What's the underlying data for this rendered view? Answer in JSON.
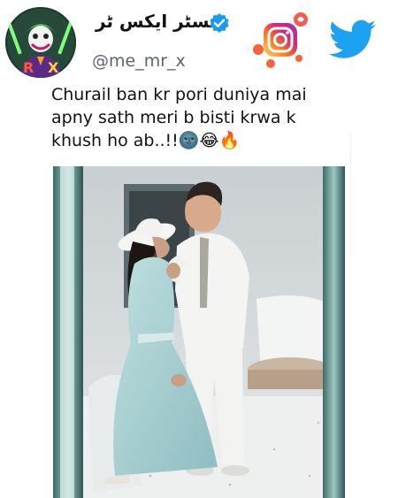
{
  "profile": {
    "display_name": "مسٹر ایکس ٹر",
    "handle": "@me_mr_x",
    "verified": true,
    "avatar_icon": "joker-avatar-icon"
  },
  "header_icons": [
    "instagram-icon",
    "twitter-icon"
  ],
  "tweet": {
    "text": "Churail ban kr pori duniya mai\napny sath meri b bisti krwa k\nkhush ho ab..!!🌚😂🔥"
  },
  "photo": {
    "subject": "couple-photo"
  },
  "colors": {
    "verified_blue": "#1d9bf0",
    "twitter_blue": "#1da1f2",
    "instagram_orange": "#f4633a",
    "instagram_pink": "#e1306c"
  }
}
